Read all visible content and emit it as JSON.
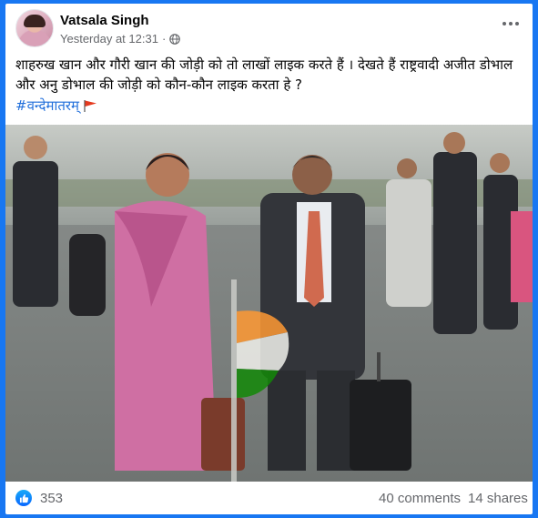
{
  "post": {
    "author": "Vatsala Singh",
    "timestamp": "Yesterday at 12:31",
    "separator": "·",
    "privacy_icon": "globe-icon",
    "text": "शाहरुख खान और गौरी खान की जोड़ी को तो लाखों लाइक करते हैं । देखते हैं राष्ट्रवादी अजीत डोभाल और अनु डोभाल की जोड़ी को कौन-कौन लाइक करता हे ?",
    "hashtag": "#वन्देमातरम्",
    "hashtag_emoji_icon": "flag-icon"
  },
  "engagement": {
    "reaction_icon": "like-icon",
    "reaction_count": "353",
    "comments": "40 comments",
    "shares": "14 shares"
  },
  "colors": {
    "frame": "#1877f2",
    "link": "#216fdb",
    "secondary_text": "#65676b",
    "saffron": "#ff9933",
    "india_green": "#138808"
  }
}
